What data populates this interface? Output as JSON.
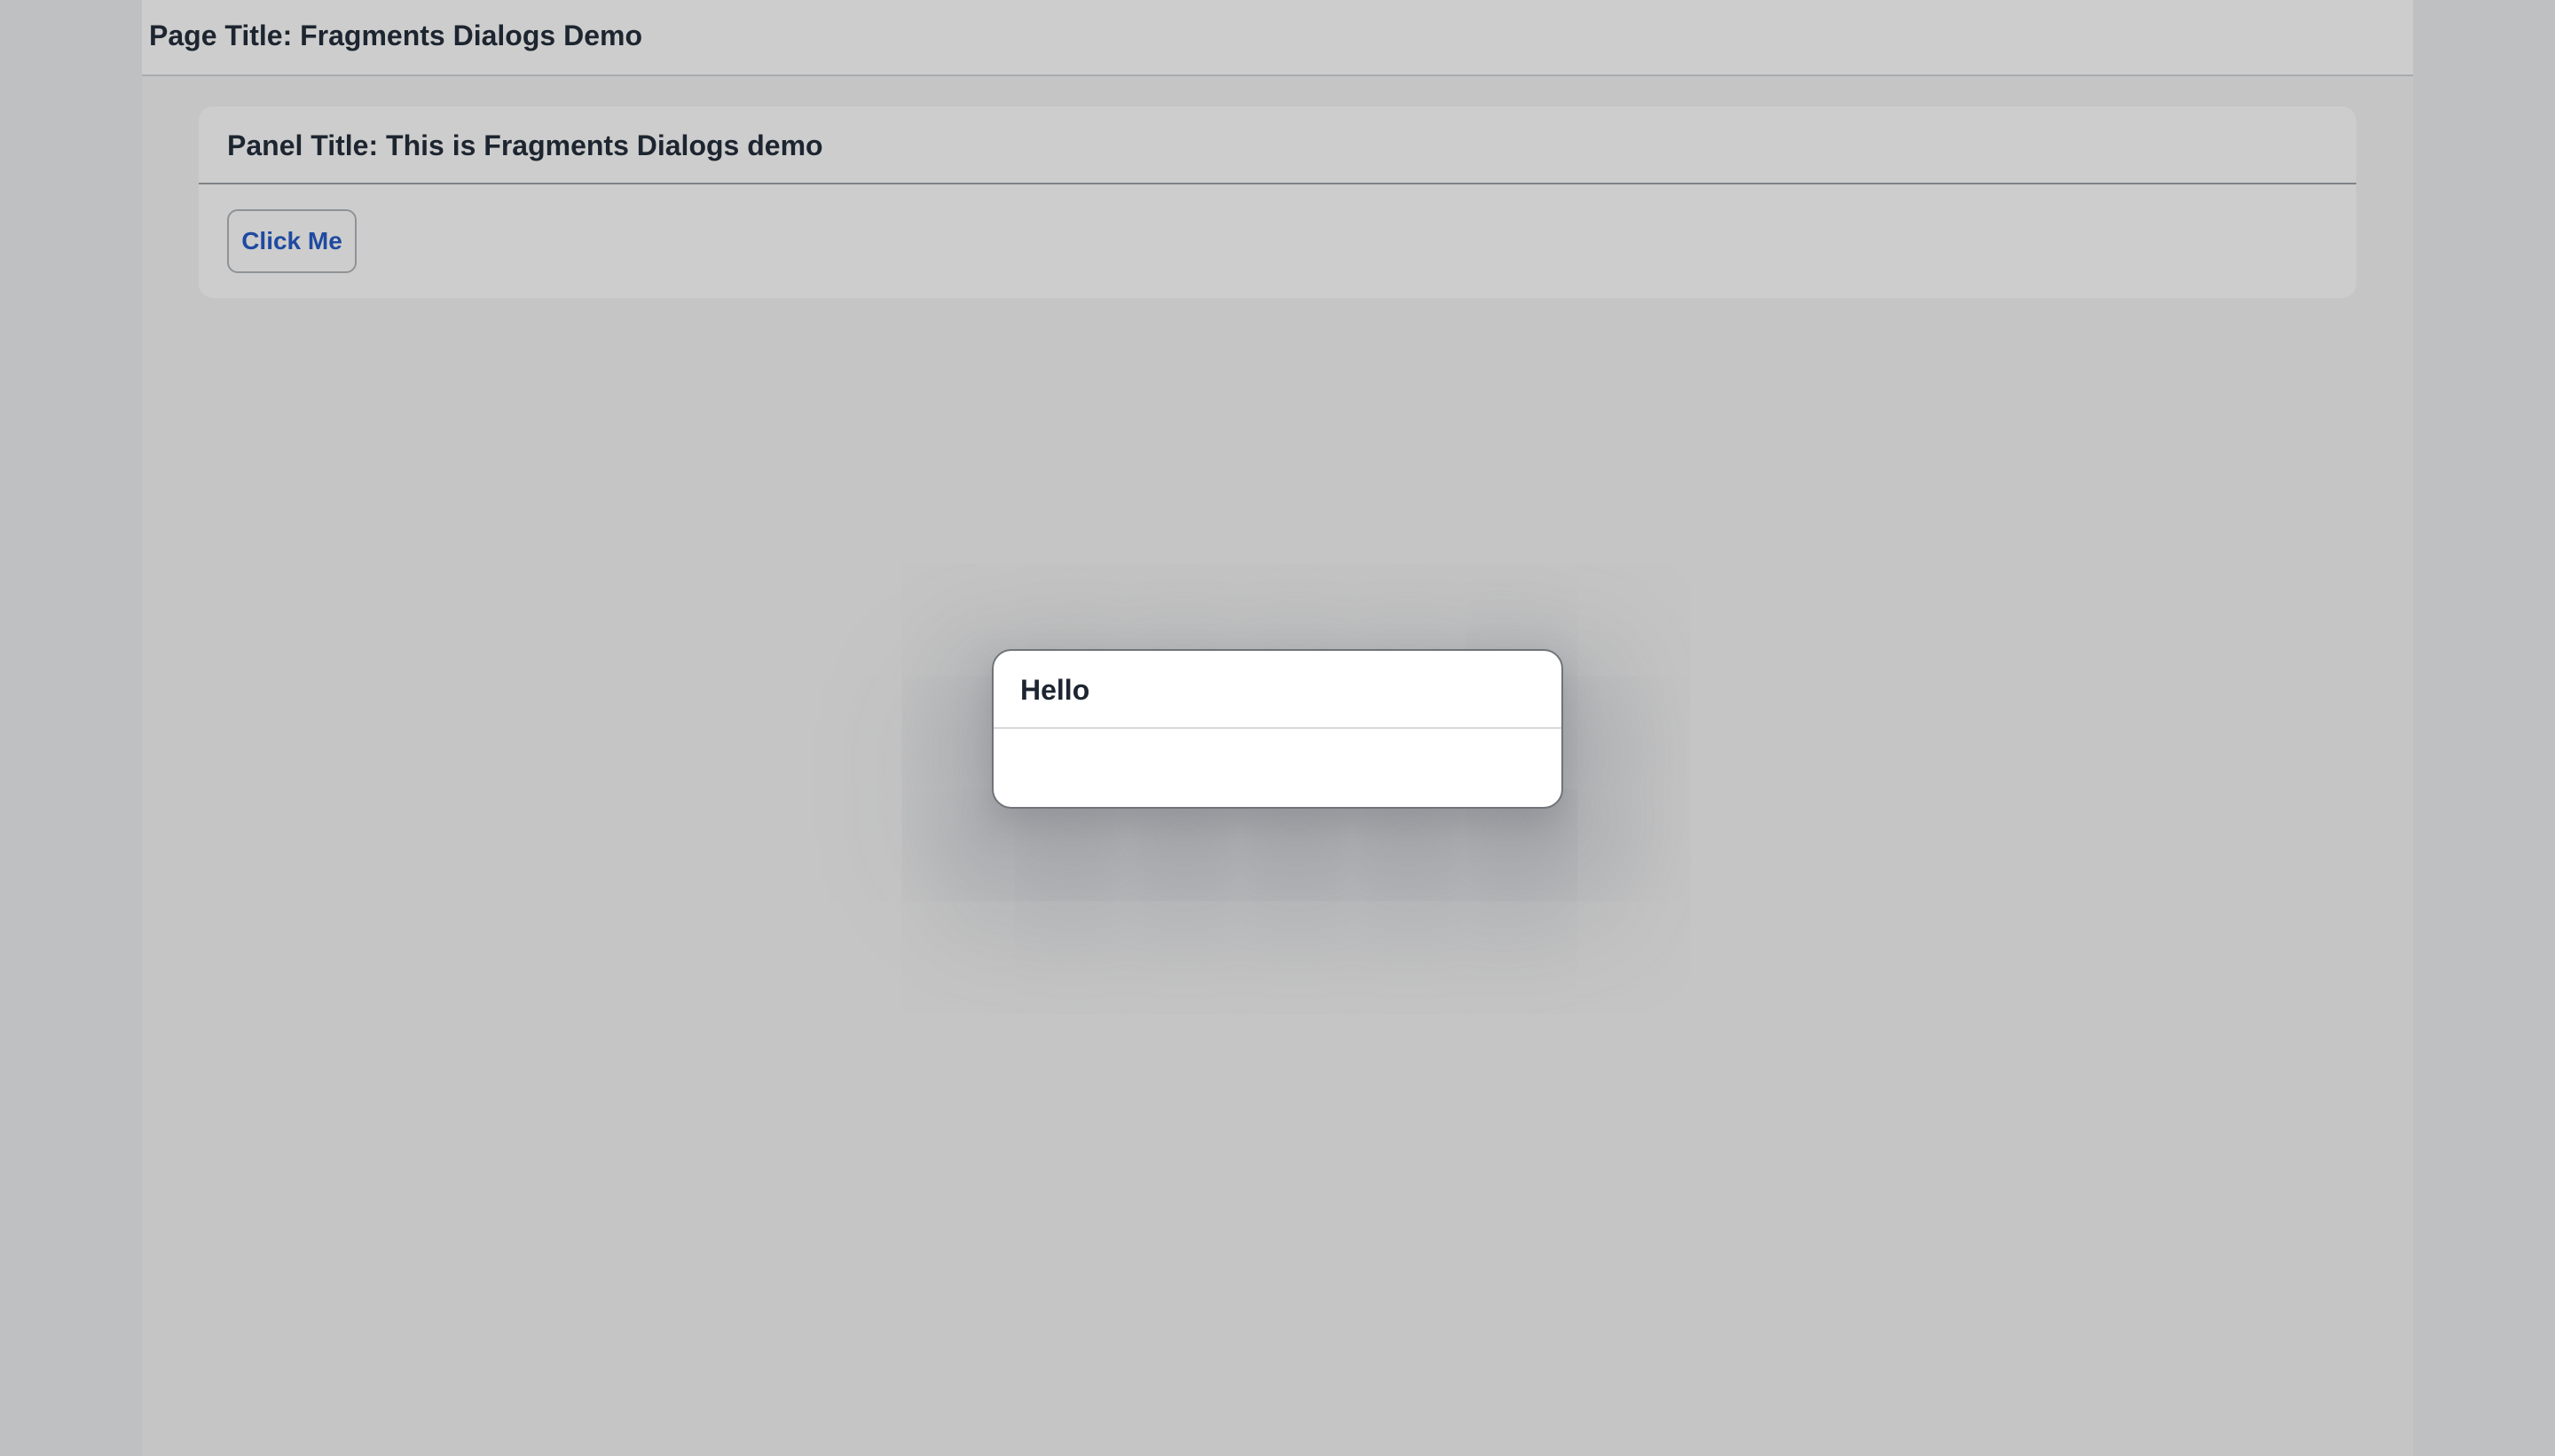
{
  "page": {
    "title": "Page Title: Fragments Dialogs Demo"
  },
  "panel": {
    "title": "Panel Title: This is Fragments Dialogs demo",
    "button_label": "Click Me"
  },
  "dialog": {
    "title": "Hello"
  },
  "colors": {
    "accent": "#1f4aa0",
    "text": "#1d2530",
    "overlay": "#c5c5c5",
    "dialog_bg": "#ffffff"
  }
}
